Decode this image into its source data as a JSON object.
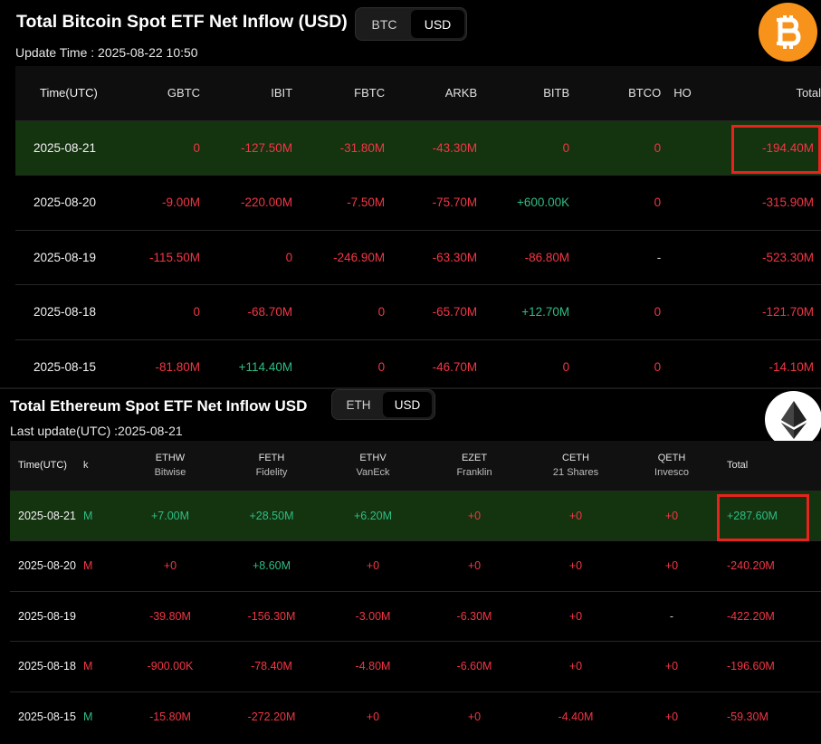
{
  "btc": {
    "title": "Total Bitcoin Spot ETF Net Inflow (USD)",
    "toggle": [
      "BTC",
      "USD"
    ],
    "toggle_active": 1,
    "update": "Update Time : 2025-08-22 10:50",
    "logo_icon": "bitcoin-icon",
    "logo_color": "#f7931a",
    "columns": [
      "Time(UTC)",
      "GBTC",
      "IBIT",
      "FBTC",
      "ARKB",
      "BITB",
      "BTCO",
      "HO",
      "Total"
    ],
    "rows": [
      {
        "time": "2025-08-21",
        "cells": [
          "0",
          "-127.50M",
          "-31.80M",
          "-43.30M",
          "0",
          "0",
          "",
          "-194.40M"
        ],
        "highlight": true
      },
      {
        "time": "2025-08-20",
        "cells": [
          "-9.00M",
          "-220.00M",
          "-7.50M",
          "-75.70M",
          "+600.00K",
          "0",
          "",
          "-315.90M"
        ]
      },
      {
        "time": "2025-08-19",
        "cells": [
          "-115.50M",
          "0",
          "-246.90M",
          "-63.30M",
          "-86.80M",
          "-",
          "",
          "-523.30M"
        ]
      },
      {
        "time": "2025-08-18",
        "cells": [
          "0",
          "-68.70M",
          "0",
          "-65.70M",
          "+12.70M",
          "0",
          "",
          "-121.70M"
        ]
      },
      {
        "time": "2025-08-15",
        "cells": [
          "-81.80M",
          "+114.40M",
          "0",
          "-46.70M",
          "0",
          "0",
          "",
          "-14.10M"
        ]
      }
    ]
  },
  "eth": {
    "title": "Total Ethereum Spot ETF Net Inflow USD",
    "toggle": [
      "ETH",
      "USD"
    ],
    "toggle_active": 1,
    "update": "Last update(UTC) :2025-08-21",
    "logo_icon": "ethereum-icon",
    "columns": [
      {
        "name": "Time(UTC)",
        "sub": ""
      },
      {
        "name": "k",
        "sub": ""
      },
      {
        "name": "ETHW",
        "sub": "Bitwise"
      },
      {
        "name": "FETH",
        "sub": "Fidelity"
      },
      {
        "name": "ETHV",
        "sub": "VanEck"
      },
      {
        "name": "EZET",
        "sub": "Franklin"
      },
      {
        "name": "CETH",
        "sub": "21 Shares"
      },
      {
        "name": "QETH",
        "sub": "Invesco"
      },
      {
        "name": "Total",
        "sub": ""
      }
    ],
    "rows": [
      {
        "time": "2025-08-21",
        "cells": [
          "M",
          "+7.00M",
          "+28.50M",
          "+6.20M",
          "+0",
          "+0",
          "+0",
          "+287.60M"
        ],
        "highlight": true
      },
      {
        "time": "2025-08-20",
        "cells": [
          "M",
          "+0",
          "+8.60M",
          "+0",
          "+0",
          "+0",
          "+0",
          "-240.20M"
        ]
      },
      {
        "time": "2025-08-19",
        "cells": [
          "",
          "-39.80M",
          "-156.30M",
          "-3.00M",
          "-6.30M",
          "+0",
          "-",
          "-422.20M"
        ]
      },
      {
        "time": "2025-08-18",
        "cells": [
          "M",
          "-900.00K",
          "-78.40M",
          "-4.80M",
          "-6.60M",
          "+0",
          "+0",
          "-196.60M"
        ]
      },
      {
        "time": "2025-08-15",
        "cells": [
          "M",
          "-15.80M",
          "-272.20M",
          "+0",
          "+0",
          "-4.40M",
          "+0",
          "-59.30M"
        ]
      }
    ]
  },
  "colors": {
    "negative": "#f23645",
    "positive": "#2ebd85",
    "highlight_row": "#14330f",
    "annotation_box": "#e8231d"
  }
}
